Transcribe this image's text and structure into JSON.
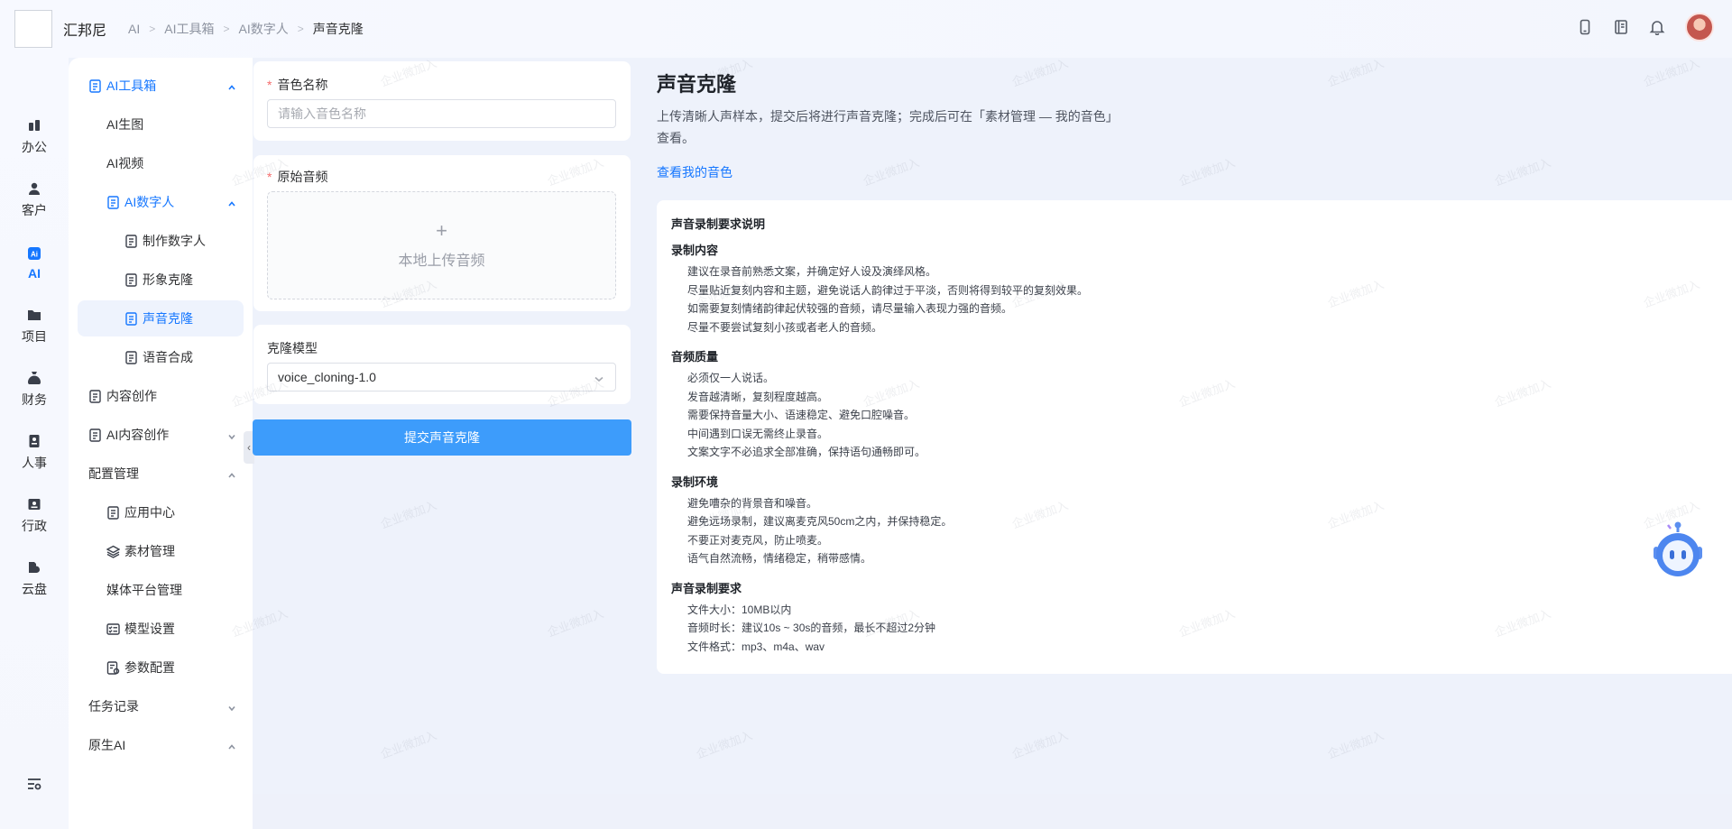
{
  "header": {
    "brand": "汇邦尼",
    "breadcrumb": [
      "AI",
      "AI工具箱",
      "AI数字人",
      "声音克隆"
    ]
  },
  "rail": [
    {
      "label": "办公",
      "icon": "briefcase-icon"
    },
    {
      "label": "客户",
      "icon": "user-icon"
    },
    {
      "label": "AI",
      "icon": "ai-icon",
      "active": true
    },
    {
      "label": "项目",
      "icon": "folder-icon"
    },
    {
      "label": "财务",
      "icon": "money-bag-icon"
    },
    {
      "label": "人事",
      "icon": "badge-icon"
    },
    {
      "label": "行政",
      "icon": "id-card-icon"
    },
    {
      "label": "云盘",
      "icon": "cloud-drive-icon"
    }
  ],
  "menu": {
    "ai_toolbox": "AI工具箱",
    "ai_image": "AI生图",
    "ai_video": "AI视频",
    "ai_digital_human": "AI数字人",
    "make_digital_human": "制作数字人",
    "image_clone": "形象克隆",
    "voice_clone": "声音克隆",
    "speech_synthesis": "语音合成",
    "content_creation": "内容创作",
    "ai_content_creation": "AI内容创作",
    "config_management": "配置管理",
    "app_center": "应用中心",
    "material_management": "素材管理",
    "media_platform": "媒体平台管理",
    "model_settings": "模型设置",
    "param_config": "参数配置",
    "task_records": "任务记录",
    "native_ai": "原生AI"
  },
  "form": {
    "voice_name_label": "音色名称",
    "voice_name_placeholder": "请输入音色名称",
    "voice_name_value": "",
    "original_audio_label": "原始音频",
    "upload_plus": "+",
    "upload_text": "本地上传音频",
    "model_label": "克隆模型",
    "model_value": "voice_cloning-1.0",
    "submit_label": "提交声音克隆"
  },
  "info": {
    "title": "声音克隆",
    "description": "上传清晰人声样本，提交后将进行声音克隆；完成后可在「素材管理 — 我的音色」查看。",
    "link": "查看我的音色",
    "requirements_title": "声音录制要求说明",
    "sections": [
      {
        "title": "录制内容",
        "lines": [
          "建议在录音前熟悉文案，并确定好人设及演绎风格。",
          "尽量贴近复刻内容和主题，避免说话人韵律过于平淡，否则将得到较平的复刻效果。",
          "如需要复刻情绪韵律起伏较强的音频，请尽量输入表现力强的音频。",
          "尽量不要尝试复刻小孩或者老人的音频。"
        ]
      },
      {
        "title": "音频质量",
        "lines": [
          "必须仅一人说话。",
          "发音越清晰，复刻程度越高。",
          "需要保持音量大小、语速稳定、避免口腔噪音。",
          "中间遇到口误无需终止录音。",
          "文案文字不必追求全部准确，保持语句通畅即可。"
        ]
      },
      {
        "title": "录制环境",
        "lines": [
          "避免嘈杂的背景音和噪音。",
          "避免远场录制，建议离麦克风50cm之内，并保持稳定。",
          "不要正对麦克风，防止喷麦。",
          "语气自然流畅，情绪稳定，稍带感情。"
        ]
      },
      {
        "title": "声音录制要求",
        "lines": [
          "文件大小：10MB以内",
          "音频时长：建议10s ~ 30s的音频，最长不超过2分钟",
          "文件格式：mp3、m4a、wav"
        ]
      }
    ]
  },
  "watermark": "企业微加入",
  "colors": {
    "accent": "#1677ff",
    "primary_button": "#3d9cfb",
    "required": "#f56c6c"
  }
}
